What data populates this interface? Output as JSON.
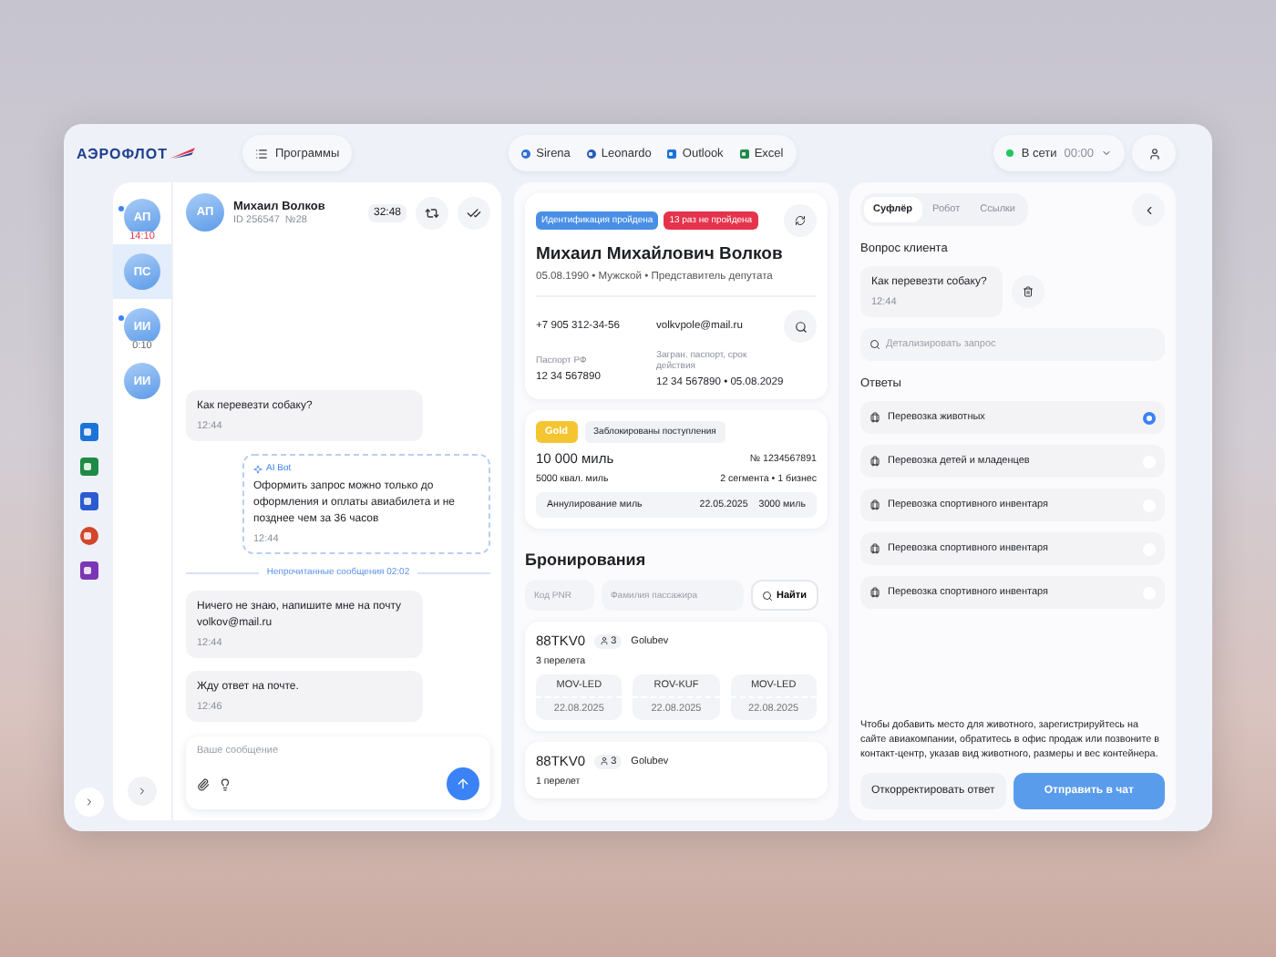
{
  "header": {
    "logo": "АЭРОФЛОТ",
    "programs_button": "Программы",
    "apps": [
      {
        "label": "Sirena",
        "kind": "sirena"
      },
      {
        "label": "Leonardo",
        "kind": "leonardo"
      },
      {
        "label": "Outlook",
        "kind": "outlook"
      },
      {
        "label": "Excel",
        "kind": "excel"
      }
    ],
    "status": {
      "label": "В сети",
      "time": "00:00",
      "online": true
    }
  },
  "side_apps": [
    {
      "kind": "outlook"
    },
    {
      "kind": "excel"
    },
    {
      "kind": "word"
    },
    {
      "kind": "powerpoint"
    },
    {
      "kind": "onenote"
    }
  ],
  "contacts": [
    {
      "initials": "АП",
      "unread": true,
      "timer": "14:10",
      "selected": false
    },
    {
      "initials": "ПС",
      "unread": false,
      "selected": true
    },
    {
      "initials": "ИИ",
      "unread": true,
      "timer": "0:10",
      "selected": false
    },
    {
      "initials": "ИИ",
      "unread": false,
      "selected": false
    }
  ],
  "chat": {
    "initials": "АП",
    "name": "Михаил Волков",
    "id": "ID 256547  №28",
    "timer": "32:48",
    "messages": [
      {
        "kind": "client",
        "text": "Как перевезти собаку?",
        "time": "12:44"
      },
      {
        "kind": "bot",
        "label": "AI Bot",
        "text": "Оформить запрос можно только до оформления и оплаты авиабилета и не позднее чем за 36 часов",
        "time": "12:44"
      },
      {
        "kind": "divider",
        "text": "Непрочитанные сообщения",
        "time": "02:02"
      },
      {
        "kind": "client",
        "text": "Ничего не знаю, напишите мне на почту volkov@mail.ru",
        "time": "12:44"
      },
      {
        "kind": "client",
        "text": "Жду ответ на почте.",
        "time": "12:46"
      }
    ],
    "composer": {
      "placeholder": "Ваше сообщение"
    }
  },
  "client": {
    "badges": [
      {
        "text": "Идентификация пройдена",
        "color": "#4a8fe6"
      },
      {
        "text": "13 раз не пройдена",
        "color": "#e5334b"
      }
    ],
    "name": "Михаил Михайлович Волков",
    "details": "05.08.1990 • Мужской • Представитель депутата",
    "phone": "+7 905 312-34-56",
    "email": "volkvpole@mail.ru",
    "passport_label": "Паспорт РФ",
    "passport": "12 34 567890",
    "foreign_label": "Загран. паспорт, срок действия",
    "foreign": "12 34 567890 • 05.08.2029"
  },
  "loyalty": {
    "tier": "Gold",
    "tag": "Заблокированы поступления",
    "miles": "10 000 миль",
    "number": "№ 1234567891",
    "qual": "5000 квал. миль",
    "segments": "2 сегмента • 1 бизнес",
    "expiry": {
      "label": "Аннулирование миль",
      "date": "22.05.2025",
      "amount": "3000 миль"
    }
  },
  "bookings": {
    "title": "Бронирования",
    "pnr_placeholder": "Код PNR",
    "surname_placeholder": "Фамилия пассажира",
    "find_button": "Найти",
    "items": [
      {
        "pnr": "88TKV0",
        "pax": "3",
        "surname": "Golubev",
        "count": "3 перелета",
        "flights": [
          {
            "route": "MOV-LED",
            "date": "22.08.2025"
          },
          {
            "route": "ROV-KUF",
            "date": "22.08.2025"
          },
          {
            "route": "MOV-LED",
            "date": "22.08.2025"
          }
        ]
      },
      {
        "pnr": "88TKV0",
        "pax": "3",
        "surname": "Golubev",
        "count": "1 перелет"
      }
    ]
  },
  "assistant": {
    "tabs": [
      {
        "label": "Суфлёр",
        "selected": true
      },
      {
        "label": "Робот",
        "selected": false
      },
      {
        "label": "Ссылки",
        "selected": false
      }
    ],
    "question_title": "Вопрос клиента",
    "question": {
      "text": "Как перевезти собаку?",
      "time": "12:44"
    },
    "detail_placeholder": "Детализировать запрос",
    "answers_title": "Ответы",
    "answers": [
      {
        "label": "Перевозка животных",
        "selected": true
      },
      {
        "label": "Перевозка детей и младенцев",
        "selected": false
      },
      {
        "label": "Перевозка спортивного инвентаря",
        "selected": false
      },
      {
        "label": "Перевозка спортивного инвентаря",
        "selected": false
      },
      {
        "label": "Перевозка спортивного инвентаря",
        "selected": false
      }
    ],
    "answer_text": "Чтобы добавить место для животного, зарегистрируйтесь на сайте авиакомпании, обратитесь в офис продаж или позвоните в контакт-центр, указав вид животного, размеры и вес контейнера.",
    "buttons": [
      {
        "label": "Откорректировать ответ",
        "kind": "secondary"
      },
      {
        "label": "Отправить в чат",
        "kind": "primary"
      }
    ]
  }
}
